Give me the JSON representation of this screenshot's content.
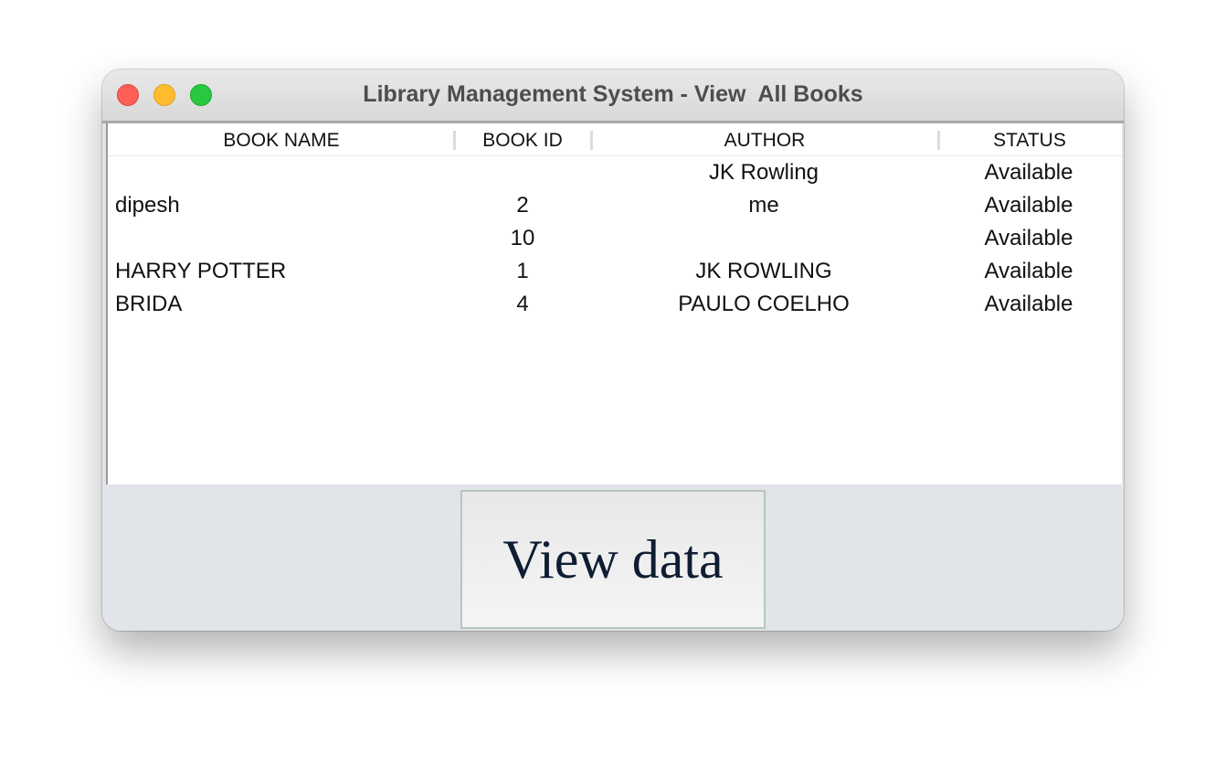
{
  "window": {
    "title": "Library Management System - View  All Books"
  },
  "table": {
    "columns": [
      "BOOK NAME",
      "BOOK ID",
      "AUTHOR",
      "STATUS"
    ],
    "rows": [
      {
        "name": "",
        "id": "",
        "author": "JK Rowling",
        "status": "Available"
      },
      {
        "name": "dipesh",
        "id": "2",
        "author": "me",
        "status": "Available"
      },
      {
        "name": "",
        "id": "10",
        "author": "",
        "status": "Available"
      },
      {
        "name": "HARRY POTTER",
        "id": "1",
        "author": "JK ROWLING",
        "status": "Available"
      },
      {
        "name": "BRIDA",
        "id": "4",
        "author": "PAULO COELHO",
        "status": "Available"
      }
    ]
  },
  "actions": {
    "view_data_label": "View data"
  }
}
